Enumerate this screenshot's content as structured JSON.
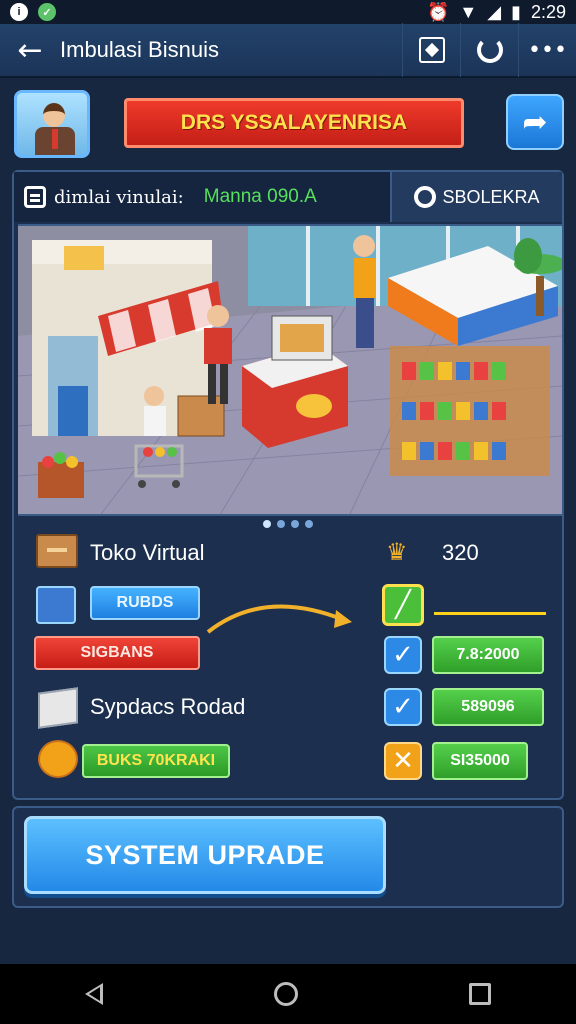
{
  "status_bar": {
    "time": "2:29"
  },
  "app_bar": {
    "title": "Imbulasi Bisnuis"
  },
  "banner": {
    "title": "DRS YSSALAYENRISA"
  },
  "panel": {
    "sim_label": "dimlai vinulai:",
    "name_label": "Manna 090.A",
    "right_label": "SBOLEKRA"
  },
  "rows": {
    "store_label": "Toko Virtual",
    "score": "320",
    "blue_pill": "RUBDS",
    "red_pill": "SIGBANS",
    "supplier_label": "Sypdacs Rodad",
    "green_pill_1": "7.8:2000",
    "green_pill_2": "589096",
    "yellow_pill": "BUKS 70KRAKI",
    "green_pill_3": "SI35000"
  },
  "upgrade": {
    "label": "SYSTEM UPRADE"
  },
  "colors": {
    "background": "#17273f",
    "accent_blue": "#2389e8",
    "accent_green": "#4cc646",
    "accent_red": "#d62b20",
    "accent_yellow": "#ffd21a"
  }
}
